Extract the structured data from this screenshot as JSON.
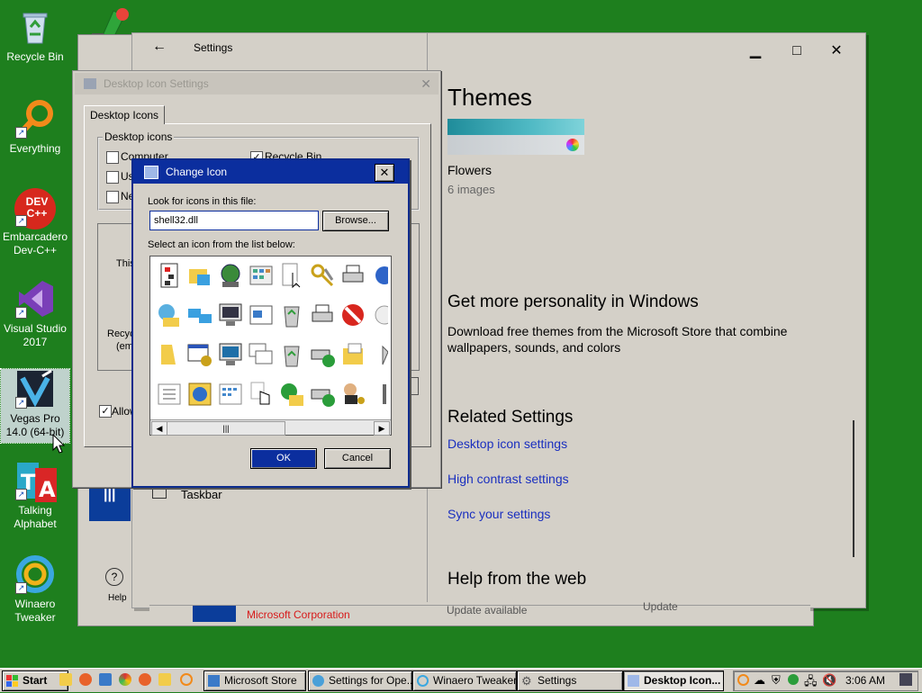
{
  "desktop": {
    "icons": [
      {
        "label": "Recycle Bin"
      },
      {
        "label": "Everything"
      },
      {
        "label": "Embarcadero Dev-C++",
        "badge": "DEV C++"
      },
      {
        "label": "Visual Studio 2017"
      },
      {
        "label": "Vegas Pro 14.0 (64-bit)"
      },
      {
        "label": "Talking Alphabet"
      },
      {
        "label": "Winaero Tweaker"
      }
    ]
  },
  "settings": {
    "title": "Settings",
    "back_icon": "back-arrow-icon",
    "minimize": "▁",
    "maximize": "□",
    "close": "✕",
    "taskbar_item": "Taskbar",
    "help_label": "Help",
    "themes_heading": "Themes",
    "theme_name": "Flowers",
    "theme_count": "6 images",
    "personality_heading": "Get more personality in Windows",
    "personality_text": "Download free themes from the Microsoft Store that combine wallpapers, sounds, and colors",
    "related_heading": "Related Settings",
    "related_links": [
      "Desktop icon settings",
      "High contrast settings",
      "Sync your settings"
    ],
    "help_heading": "Help from the web",
    "bottom_row": [
      "Microsoft Corporation",
      "Update available",
      "Update"
    ]
  },
  "desktop_icon_settings": {
    "title": "Desktop Icon Settings",
    "tab": "Desktop Icons",
    "group_label": "Desktop icons",
    "checkboxes": [
      {
        "label": "Computer",
        "checked": false
      },
      {
        "label": "Recycle Bin",
        "checked": true
      },
      {
        "label": "Us",
        "checked": false
      },
      {
        "label": "Ne",
        "checked": false
      }
    ],
    "preview_labels": [
      "This",
      "Recyc",
      "(em"
    ],
    "allow_label": "Allow",
    "side_button_fragment": "lt"
  },
  "change_icon": {
    "title": "Change Icon",
    "look_label": "Look for icons in this file:",
    "file_value": "shell32.dll",
    "browse_label": "Browse...",
    "select_label": "Select an icon from the list below:",
    "ok_label": "OK",
    "cancel_label": "Cancel"
  },
  "taskbar": {
    "start_label": "Start",
    "buttons": [
      {
        "label": "Microsoft Store"
      },
      {
        "label": "Settings for Ope..."
      },
      {
        "label": "Winaero Tweaker"
      },
      {
        "label": "Settings"
      },
      {
        "label": "Desktop Icon..."
      }
    ],
    "clock": "3:06 AM"
  },
  "colors": {
    "desktop_bg": "#1e7f1e",
    "window_face": "#d4d0c8",
    "active_title": "#0b2e9e",
    "link": "#1a2fbf"
  }
}
